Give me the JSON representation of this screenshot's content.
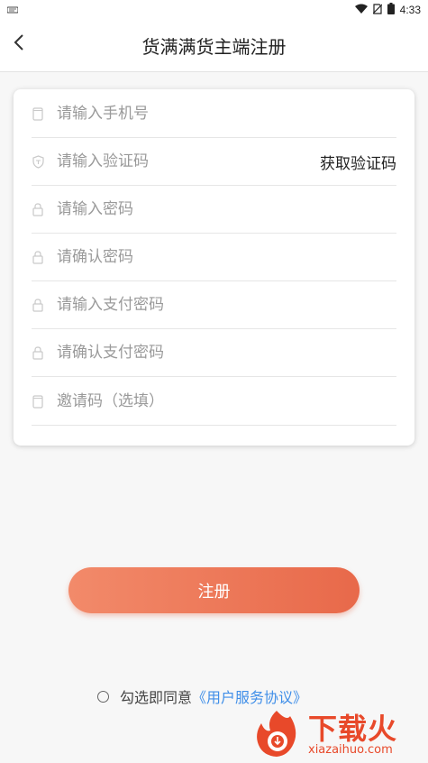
{
  "status_bar": {
    "time": "4:33",
    "icons": [
      "notification-icon",
      "wifi-icon",
      "no-sim-icon",
      "battery-icon"
    ]
  },
  "header": {
    "title": "货满满货主端注册",
    "back_icon": "back-arrow-icon"
  },
  "form": {
    "fields": [
      {
        "name": "phone",
        "placeholder": "请输入手机号",
        "icon": "phone-icon"
      },
      {
        "name": "code",
        "placeholder": "请输入验证码",
        "icon": "shield-icon"
      },
      {
        "name": "password",
        "placeholder": "请输入密码",
        "icon": "lock-icon"
      },
      {
        "name": "password_confirm",
        "placeholder": "请确认密码",
        "icon": "lock-icon"
      },
      {
        "name": "pay_password",
        "placeholder": "请输入支付密码",
        "icon": "lock-icon"
      },
      {
        "name": "pay_password_confirm",
        "placeholder": "请确认支付密码",
        "icon": "lock-icon"
      },
      {
        "name": "invite_code",
        "placeholder": "邀请码（选填）",
        "icon": "phone-icon"
      }
    ],
    "get_code_label": "获取验证码"
  },
  "register_label": "注册",
  "agreement": {
    "prefix": "勾选即同意",
    "link": "《用户服务协议》"
  },
  "watermark": {
    "title": "下载火",
    "url": "xiazaihuo.com"
  },
  "colors": {
    "accent_start": "#f28a6a",
    "accent_end": "#e8694a",
    "link": "#3f8ee8",
    "watermark": "#e8492a"
  }
}
